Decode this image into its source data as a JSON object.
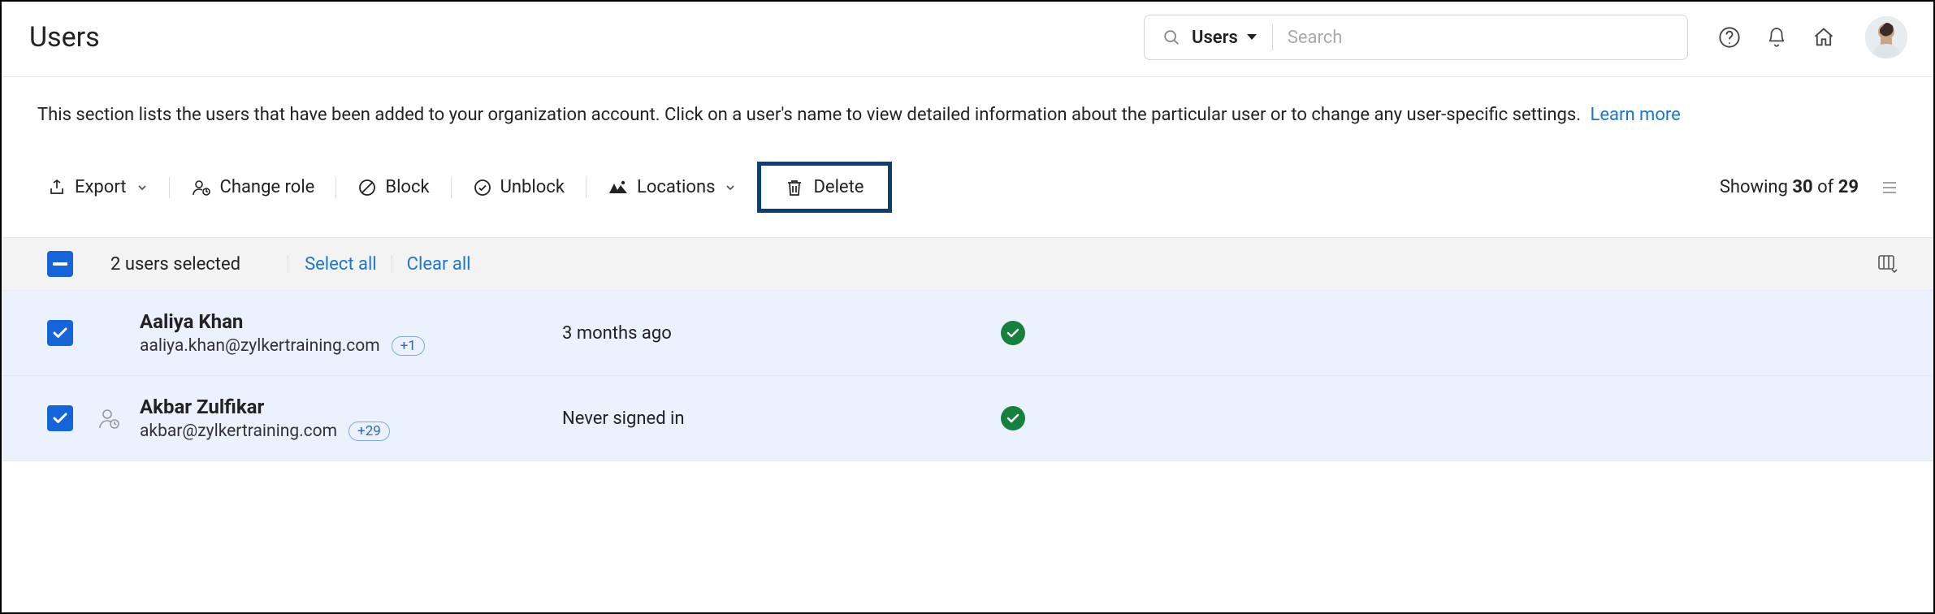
{
  "header": {
    "page_title": "Users",
    "search_scope_label": "Users",
    "search_placeholder": "Search"
  },
  "description": {
    "text": "This section lists the users that have been added to your organization account. Click on a user's name to view detailed information about the particular user or to change any user-specific settings.",
    "learn_more": "Learn more"
  },
  "toolbar": {
    "export": "Export",
    "change_role": "Change role",
    "block": "Block",
    "unblock": "Unblock",
    "locations": "Locations",
    "delete": "Delete",
    "showing_prefix": "Showing ",
    "showing_count": "30",
    "showing_of": " of ",
    "showing_total": "29"
  },
  "selection": {
    "summary": "2 users selected",
    "select_all": "Select all",
    "clear_all": "Clear all"
  },
  "rows": [
    {
      "name": "Aaliya Khan",
      "email": "aaliya.khan@zylkertraining.com",
      "badge": "+1",
      "time": "3 months ago",
      "has_role_icon": false,
      "checked": true,
      "status_ok": true
    },
    {
      "name": "Akbar Zulfikar",
      "email": "akbar@zylkertraining.com",
      "badge": "+29",
      "time": "Never signed in",
      "has_role_icon": true,
      "checked": true,
      "status_ok": true
    }
  ]
}
